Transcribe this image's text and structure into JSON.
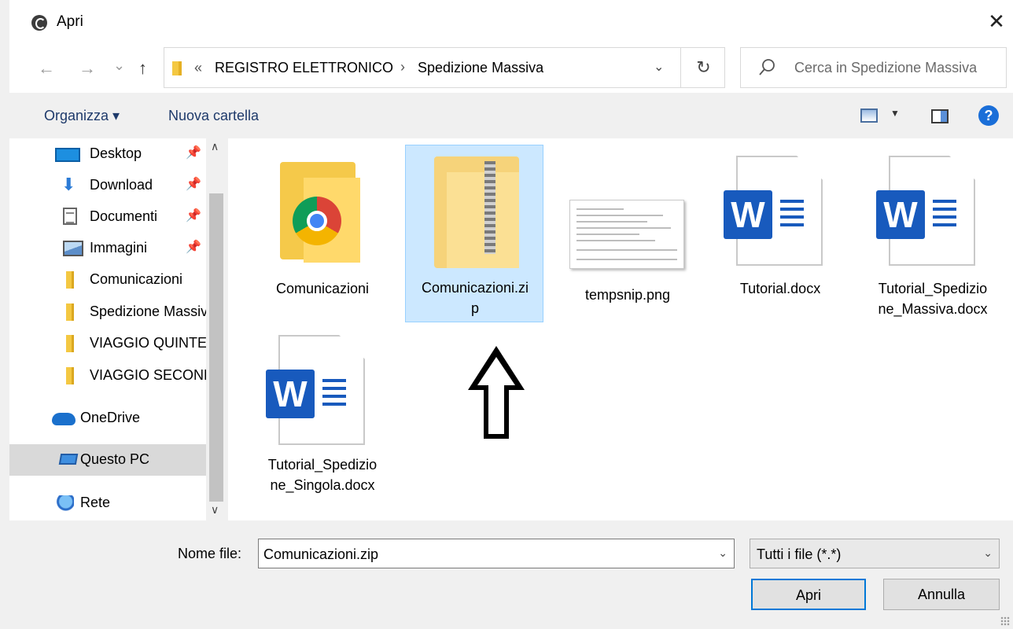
{
  "window": {
    "title": "Apri",
    "close_glyph": "✕"
  },
  "nav": {
    "back_glyph": "←",
    "forward_glyph": "→",
    "recent_glyph": "⌄",
    "up_glyph": "↑"
  },
  "address": {
    "overflow": "«",
    "crumbs": [
      "REGISTRO ELETTRONICO",
      "Spedizione Massiva"
    ],
    "separator": "›",
    "dropdown_glyph": "⌄",
    "refresh_glyph": "↻"
  },
  "search": {
    "placeholder": "Cerca in Spedizione Massiva"
  },
  "toolbar": {
    "organize": "Organizza ▾",
    "new_folder": "Nuova cartella",
    "view_dd": "▼",
    "help": "?"
  },
  "sidebar": {
    "pin": "📌",
    "items": [
      {
        "label": "Desktop"
      },
      {
        "label": "Download"
      },
      {
        "label": "Documenti"
      },
      {
        "label": "Immagini"
      },
      {
        "label": "Comunicazioni"
      },
      {
        "label": "Spedizione Massiva"
      },
      {
        "label": "VIAGGIO QUINTE"
      },
      {
        "label": "VIAGGIO SECONDE"
      },
      {
        "label": "OneDrive"
      },
      {
        "label": "Questo PC"
      },
      {
        "label": "Rete"
      }
    ],
    "scroll_up": "∧",
    "scroll_down": "∨"
  },
  "files": [
    {
      "name": "Comunicazioni",
      "icon": "chrome-folder-icon"
    },
    {
      "name_line1": "Comunicazioni.zi",
      "name_line2": "p",
      "icon": "zip-folder-icon"
    },
    {
      "name": "tempsnip.png",
      "icon": "image-thumbnail"
    },
    {
      "name": "Tutorial.docx",
      "icon": "word-document-icon"
    },
    {
      "name_line1": "Tutorial_Spedizio",
      "name_line2": "ne_Massiva.docx",
      "icon": "word-document-icon"
    },
    {
      "name_line1": "Tutorial_Spedizio",
      "name_line2": "ne_Singola.docx",
      "icon": "word-document-icon"
    }
  ],
  "bottom": {
    "filename_label": "Nome file:",
    "filename_value": "Comunicazioni.zip",
    "filetype": "Tutti i file (*.*)",
    "dd_glyph": "⌄",
    "open_button": "Apri",
    "cancel_button": "Annulla"
  },
  "colors": {
    "accent": "#0078d7",
    "selection": "#cce8ff",
    "word_blue": "#185abd"
  }
}
